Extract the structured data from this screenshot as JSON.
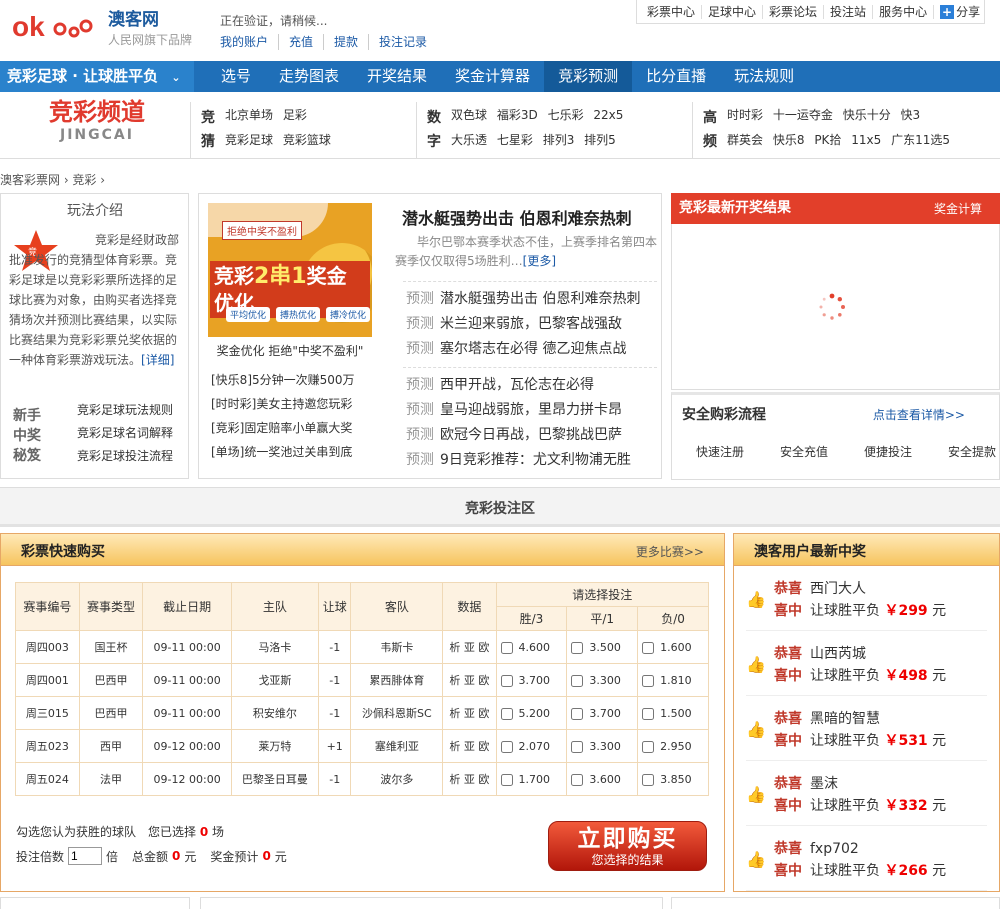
{
  "header": {
    "brand": "澳客网",
    "brand_sub": "人民网旗下品牌",
    "verify": "正在验证，请稍候...",
    "account_links": [
      "我的账户",
      "充值",
      "提款",
      "投注记录"
    ],
    "top_links": [
      "彩票中心",
      "足球中心",
      "彩票论坛",
      "投注站",
      "服务中心"
    ],
    "share": "分享"
  },
  "nav": {
    "title": "竞彩足球 · 让球胜平负",
    "items": [
      "选号",
      "走势图表",
      "开奖结果",
      "奖金计算器",
      "竞彩预测",
      "比分直播",
      "玩法规则"
    ],
    "active": "竞彩预测"
  },
  "channel": {
    "logo_cn": "竞彩频道",
    "logo_en": "JINGCAI",
    "groups": [
      {
        "label": "竞猜",
        "rows": [
          [
            "北京单场",
            "足彩"
          ],
          [
            "竞彩足球",
            "竞彩篮球"
          ]
        ]
      },
      {
        "label": "数字",
        "rows": [
          [
            "双色球",
            "福彩3D",
            "七乐彩",
            "22x5"
          ],
          [
            "大乐透",
            "七星彩",
            "排列3",
            "排列5"
          ]
        ]
      },
      {
        "label": "高频",
        "rows": [
          [
            "时时彩",
            "十一运夺金",
            "快乐十分",
            "快3"
          ],
          [
            "群英会",
            "快乐8",
            "PK拾",
            "11x5",
            "广东11选5"
          ]
        ]
      }
    ]
  },
  "breadcrumb": "澳客彩票网 › 竞彩 ›",
  "intro": {
    "title": "玩法介绍",
    "text": "竞彩是经财政部批准发行的竞猜型体育彩票。竞彩足球是以竞彩彩票所选择的足球比赛为对象，由购买者选择竞猜场次并预测比赛结果，以实际比赛结果为竞彩彩票兑奖依据的一种体育彩票游戏玩法。",
    "more": "[详细]"
  },
  "tips": {
    "label": "新手中奖秘笈",
    "links": [
      "竞彩足球玩法规则",
      "竞彩足球名词解释",
      "竞彩足球投注流程"
    ]
  },
  "promo": {
    "reject": "拒绝中奖不盈利",
    "big_prefix": "竞彩",
    "big_hl": "2串1",
    "big_suffix": "奖金优化",
    "chips": [
      "平均优化",
      "搏热优化",
      "搏冷优化"
    ],
    "caption": "奖金优化 拒绝\"中奖不盈利\"",
    "links": [
      "[快乐8]5分钟一次赚500万",
      "[时时彩]美女主持邀您玩彩",
      "[竞彩]固定赔率小单赢大奖",
      "[单场]统一奖池过关串到底"
    ]
  },
  "news": {
    "headline": "潜水艇强势出击 伯恩利难奈热刺",
    "summary": "毕尔巴鄂本赛季状态不佳，上赛季排名第四本赛季仅仅取得5场胜利…",
    "more": "[更多]",
    "tag": "预测",
    "group1": [
      "潜水艇强势出击 伯恩利难奈热刺",
      "米兰迎来弱旅，巴黎客战强敌",
      "塞尔塔志在必得 德乙迎焦点战"
    ],
    "group2": [
      "西甲开战，瓦伦志在必得",
      "皇马迎战弱旅，里昂力拼卡昂",
      "欧冠今日再战，巴黎挑战巴萨",
      "9日竞彩推荐：尤文利物浦无胜"
    ]
  },
  "results": {
    "title": "竞彩最新开奖结果",
    "calc": "奖金计算"
  },
  "process": {
    "title": "安全购彩流程",
    "detail": "点击查看详情>>",
    "steps": [
      "快速注册",
      "安全充值",
      "便捷投注",
      "安全提款"
    ]
  },
  "zone": "竞彩投注区",
  "buy": {
    "title": "彩票快速购买",
    "more": "更多比赛>>",
    "headers": [
      "赛事编号",
      "赛事类型",
      "截止日期",
      "主队",
      "让球",
      "客队",
      "数据",
      "请选择投注"
    ],
    "subheaders": [
      "胜/3",
      "平/1",
      "负/0"
    ],
    "data_links": "析 亚 欧",
    "rows": [
      {
        "id": "周四003",
        "type": "国王杯",
        "date": "09-11 00:00",
        "home": "马洛卡",
        "handicap": "-1",
        "away": "韦斯卡",
        "win": "4.600",
        "draw": "3.500",
        "lose": "1.600"
      },
      {
        "id": "周四001",
        "type": "巴西甲",
        "date": "09-11 00:00",
        "home": "戈亚斯",
        "handicap": "-1",
        "away": "累西腓体育",
        "win": "3.700",
        "draw": "3.300",
        "lose": "1.810"
      },
      {
        "id": "周三015",
        "type": "巴西甲",
        "date": "09-11 00:00",
        "home": "积安维尔",
        "handicap": "-1",
        "away": "沙佩科恩斯SC",
        "win": "5.200",
        "draw": "3.700",
        "lose": "1.500"
      },
      {
        "id": "周五023",
        "type": "西甲",
        "date": "09-12 00:00",
        "home": "莱万特",
        "handicap": "+1",
        "away": "塞维利亚",
        "win": "2.070",
        "draw": "3.300",
        "lose": "2.950"
      },
      {
        "id": "周五024",
        "type": "法甲",
        "date": "09-12 00:00",
        "home": "巴黎圣日耳曼",
        "handicap": "-1",
        "away": "波尔多",
        "win": "1.700",
        "draw": "3.600",
        "lose": "3.850"
      }
    ],
    "pick_text_a": "勾选您认为获胜的球队　您已选择",
    "pick_count": "0",
    "pick_text_b": "场",
    "multiple_label": "投注倍数",
    "multiple_value": "1",
    "multiple_unit": "倍",
    "total_label": "总金额",
    "total_value": "0",
    "prize_label": "奖金预计",
    "prize_value": "0",
    "yuan": "元",
    "btn_main": "立即购买",
    "btn_sub": "您选择的结果"
  },
  "winners": {
    "title": "澳客用户最新中奖",
    "congrats": "恭喜",
    "won": "喜中",
    "play": "让球胜平负",
    "currency": "￥",
    "unit": "元",
    "list": [
      {
        "user": "西门大人",
        "amount": "299"
      },
      {
        "user": "山西芮城",
        "amount": "498"
      },
      {
        "user": "黑暗的智慧",
        "amount": "531"
      },
      {
        "user": "墨沫",
        "amount": "332"
      },
      {
        "user": "fxp702",
        "amount": "266"
      }
    ]
  },
  "colors": {
    "brand_red": "#e03a2e",
    "nav_blue": "#1f6fb8",
    "link_blue": "#1c5aa6",
    "panel_orange": "#f6c45e"
  }
}
